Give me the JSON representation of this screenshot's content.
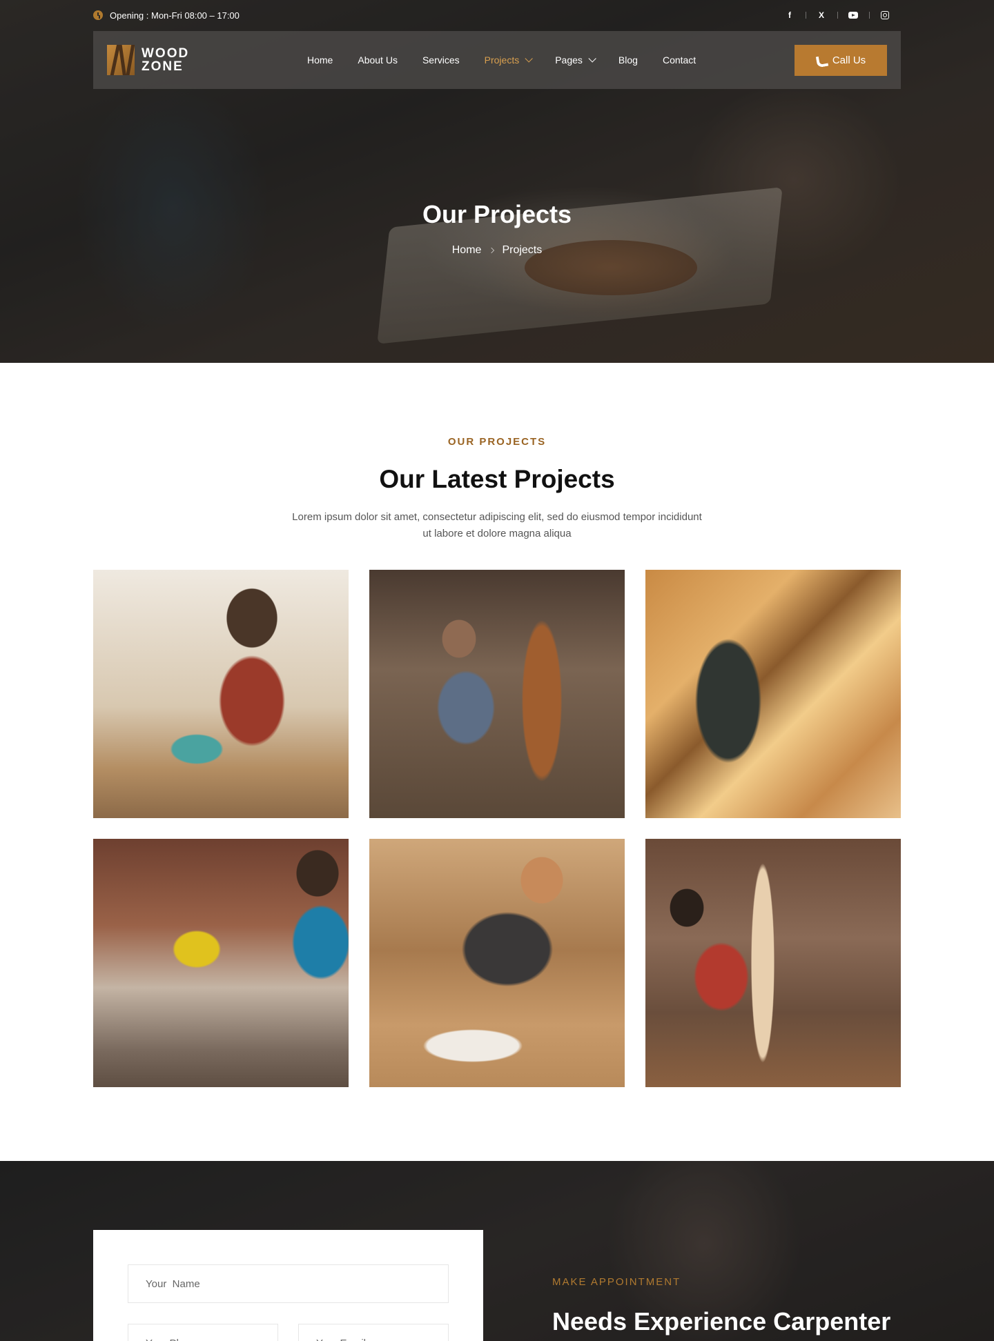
{
  "topbar": {
    "opening": "Opening : Mon-Fri 08:00 – 17:00",
    "socials": [
      {
        "icon": "facebook-icon",
        "glyph": "f"
      },
      {
        "icon": "x-twitter-icon",
        "glyph": "X"
      },
      {
        "icon": "youtube-icon",
        "glyph": ""
      },
      {
        "icon": "instagram-icon",
        "glyph": ""
      }
    ]
  },
  "logo": {
    "line1": "WOOD",
    "line2": "ZONE"
  },
  "nav": {
    "items": [
      {
        "label": "Home",
        "active": false,
        "dropdown": false
      },
      {
        "label": "About Us",
        "active": false,
        "dropdown": false
      },
      {
        "label": "Services",
        "active": false,
        "dropdown": false
      },
      {
        "label": "Projects",
        "active": true,
        "dropdown": true
      },
      {
        "label": "Pages",
        "active": false,
        "dropdown": true
      },
      {
        "label": "Blog",
        "active": false,
        "dropdown": false
      },
      {
        "label": "Contact",
        "active": false,
        "dropdown": false
      }
    ],
    "cta_label": "Call Us"
  },
  "hero": {
    "title": "Our Projects",
    "breadcrumb": [
      "Home",
      "Projects"
    ]
  },
  "projects": {
    "eyebrow": "OUR PROJECTS",
    "title": "Our Latest Projects",
    "description": "Lorem ipsum dolor sit amet, consectetur adipiscing elit, sed do eiusmod tempor incididunt ut labore et dolore magna aliqua",
    "items": [
      {
        "photo": "carpenter-using-jigsaw-photo"
      },
      {
        "photo": "woodcarver-sculpting-statue-photo"
      },
      {
        "photo": "roofer-on-timber-frame-photo"
      },
      {
        "photo": "worker-using-miter-saw-photo"
      },
      {
        "photo": "worker-sanding-wood-photo"
      },
      {
        "photo": "woman-measuring-plank-photo"
      }
    ]
  },
  "appointment": {
    "form": {
      "name_placeholder": "Your  Name",
      "phone_placeholder": "Your Phone",
      "email_placeholder": "Your Email"
    },
    "eyebrow": "MAKE APPOINTMENT",
    "title": "Needs Experience Carpenter"
  },
  "colors": {
    "accent": "#b87a30",
    "eyebrow": "#9a6423",
    "nav_active": "#d9a04f"
  }
}
